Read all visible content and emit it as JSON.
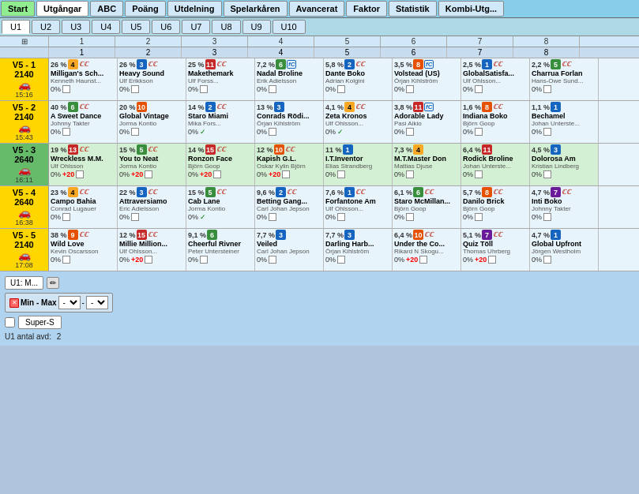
{
  "topNav": {
    "buttons": [
      {
        "label": "Start",
        "id": "start",
        "active": false
      },
      {
        "label": "Utgångar",
        "id": "utgangar",
        "active": true
      },
      {
        "label": "ABC",
        "id": "abc",
        "active": false
      },
      {
        "label": "Poäng",
        "id": "poang",
        "active": false
      },
      {
        "label": "Utdelning",
        "id": "utdelning",
        "active": false
      },
      {
        "label": "Spelarkåren",
        "id": "spelarkaren",
        "active": false
      },
      {
        "label": "Avancerat",
        "id": "avancerat",
        "active": false
      },
      {
        "label": "Faktor",
        "id": "faktor",
        "active": false
      },
      {
        "label": "Statistik",
        "id": "statistik",
        "active": false
      },
      {
        "label": "Kombi-Utg...",
        "id": "kombi",
        "active": false
      }
    ]
  },
  "tabs": [
    "U1",
    "U2",
    "U3",
    "U4",
    "U5",
    "U6",
    "U7",
    "U8",
    "U9",
    "U10"
  ],
  "activeTab": "U1",
  "colHeaders": [
    "",
    "1",
    "2",
    "3",
    "4",
    "5",
    "6",
    "7",
    "8"
  ],
  "races": [
    {
      "id": "v5-1",
      "label": "V5 - 1",
      "num": "2140",
      "time": "15:16",
      "horses": [
        {
          "pct": "26 %",
          "num": "4",
          "cc": true,
          "name": "Milligan's Sch...",
          "trainer": "Kenneth Haunst...",
          "pctBot": "0%",
          "plus": "",
          "checked": false,
          "badgeColor": "badge-yellow",
          "fcIcon": false
        },
        {
          "pct": "26 %",
          "num": "3",
          "cc": true,
          "name": "Heavy Sound",
          "trainer": "Ulf Erikkson",
          "pctBot": "0%",
          "plus": "",
          "checked": false,
          "badgeColor": "badge-blue",
          "fcIcon": false
        },
        {
          "pct": "25 %",
          "num": "11",
          "cc": true,
          "name": "Makethemark",
          "trainer": "Ulf Forss...",
          "pctBot": "0%",
          "plus": "",
          "checked": false,
          "badgeColor": "badge-red",
          "fcIcon": false
        },
        {
          "pct": "7,2 %",
          "num": "6",
          "cc": false,
          "name": "Nadal Broline",
          "trainer": "Erik Adielsson",
          "pctBot": "0%",
          "plus": "",
          "checked": false,
          "badgeColor": "badge-green",
          "fcIcon": true
        },
        {
          "pct": "5,8 %",
          "num": "2",
          "cc": true,
          "name": "Dante Boko",
          "trainer": "Adrian Kolgini",
          "pctBot": "0%",
          "plus": "",
          "checked": false,
          "badgeColor": "badge-blue",
          "fcIcon": false
        },
        {
          "pct": "3,5 %",
          "num": "8",
          "cc": false,
          "name": "Volstead (US)",
          "trainer": "Örjan Kihlström",
          "pctBot": "0%",
          "plus": "",
          "checked": false,
          "badgeColor": "badge-orange",
          "fcIcon": true
        },
        {
          "pct": "2,5 %",
          "num": "1",
          "cc": true,
          "name": "GlobalSatisfa...",
          "trainer": "Ulf Ohlsson...",
          "pctBot": "0%",
          "plus": "",
          "checked": false,
          "badgeColor": "badge-blue",
          "fcIcon": false
        },
        {
          "pct": "2,2 %",
          "num": "5",
          "cc": true,
          "name": "Charrua Forlan",
          "trainer": "Hans-Owe Sund...",
          "pctBot": "0%",
          "plus": "",
          "checked": false,
          "badgeColor": "badge-green",
          "fcIcon": false
        }
      ]
    },
    {
      "id": "v5-2",
      "label": "V5 - 2",
      "num": "2140",
      "time": "15:43",
      "horses": [
        {
          "pct": "40 %",
          "num": "6",
          "cc": true,
          "name": "A Sweet Dance",
          "trainer": "Johnny Takter",
          "pctBot": "0%",
          "plus": "",
          "checked": false,
          "badgeColor": "badge-green",
          "fcIcon": false
        },
        {
          "pct": "20 %",
          "num": "10",
          "cc": false,
          "name": "Global Vintage",
          "trainer": "Jorma Kontio",
          "pctBot": "0%",
          "plus": "",
          "checked": false,
          "badgeColor": "badge-orange",
          "fcIcon": false
        },
        {
          "pct": "14 %",
          "num": "2",
          "cc": true,
          "name": "Staro Miami",
          "trainer": "Mika Fors...",
          "pctBot": "0%",
          "plus": "",
          "checked": true,
          "badgeColor": "badge-blue",
          "fcIcon": false
        },
        {
          "pct": "13 %",
          "num": "3",
          "cc": false,
          "name": "Conrads Rödi...",
          "trainer": "Örjan Kihlström",
          "pctBot": "0%",
          "plus": "",
          "checked": false,
          "badgeColor": "badge-blue",
          "fcIcon": false
        },
        {
          "pct": "4,1 %",
          "num": "4",
          "cc": true,
          "name": "Zeta Kronos",
          "trainer": "Ulf Ohlsson...",
          "pctBot": "0%",
          "plus": "",
          "checked": true,
          "badgeColor": "badge-yellow",
          "fcIcon": false
        },
        {
          "pct": "3,8 %",
          "num": "11",
          "cc": false,
          "name": "Adorable Lady",
          "trainer": "Pasi Aikio",
          "pctBot": "0%",
          "plus": "",
          "checked": false,
          "badgeColor": "badge-red",
          "fcIcon": true
        },
        {
          "pct": "1,6 %",
          "num": "8",
          "cc": true,
          "name": "Indiana Boko",
          "trainer": "Björn Goop",
          "pctBot": "0%",
          "plus": "",
          "checked": false,
          "badgeColor": "badge-orange",
          "fcIcon": false
        },
        {
          "pct": "1,1 %",
          "num": "1",
          "cc": false,
          "name": "Bechamel",
          "trainer": "Johan Unterste...",
          "pctBot": "0%",
          "plus": "",
          "checked": false,
          "badgeColor": "badge-blue",
          "fcIcon": false
        }
      ]
    },
    {
      "id": "v5-3",
      "label": "V5 - 3",
      "num": "2640",
      "time": "16:11",
      "highlight": true,
      "horses": [
        {
          "pct": "19 %",
          "num": "13",
          "cc": true,
          "name": "Wreckless M.M.",
          "trainer": "Ulf Ohlsson",
          "pctBot": "0%",
          "plus": "+20",
          "checked": false,
          "badgeColor": "badge-red",
          "fcIcon": false
        },
        {
          "pct": "15 %",
          "num": "5",
          "cc": true,
          "name": "You to Neat",
          "trainer": "Jorma Kontio",
          "pctBot": "0%",
          "plus": "+20",
          "checked": false,
          "badgeColor": "badge-green",
          "fcIcon": false
        },
        {
          "pct": "14 %",
          "num": "15",
          "cc": true,
          "name": "Ronzon Face",
          "trainer": "Björn Goop",
          "pctBot": "0%",
          "plus": "+20",
          "checked": false,
          "badgeColor": "badge-red",
          "fcIcon": false
        },
        {
          "pct": "12 %",
          "num": "10",
          "cc": true,
          "name": "Kapish G.L.",
          "trainer": "Oskar Kylin Björn",
          "pctBot": "0%",
          "plus": "+20",
          "checked": false,
          "badgeColor": "badge-orange",
          "fcIcon": false
        },
        {
          "pct": "11 %",
          "num": "1",
          "cc": false,
          "name": "I.T.Inventor",
          "trainer": "Elias Strandberg",
          "pctBot": "0%",
          "plus": "",
          "checked": false,
          "badgeColor": "badge-blue",
          "fcIcon": false
        },
        {
          "pct": "7,3 %",
          "num": "4",
          "cc": false,
          "name": "M.T.Master Don",
          "trainer": "Mattias Djuse",
          "pctBot": "0%",
          "plus": "",
          "checked": false,
          "badgeColor": "badge-yellow",
          "fcIcon": false
        },
        {
          "pct": "6,4 %",
          "num": "11",
          "cc": false,
          "name": "Rodick Broline",
          "trainer": "Johan Unterste...",
          "pctBot": "0%",
          "plus": "",
          "checked": false,
          "badgeColor": "badge-red",
          "fcIcon": false
        },
        {
          "pct": "4,5 %",
          "num": "3",
          "cc": false,
          "name": "Dolorosa Am",
          "trainer": "Kristian Lindberg",
          "pctBot": "0%",
          "plus": "",
          "checked": false,
          "badgeColor": "badge-blue",
          "fcIcon": false
        }
      ]
    },
    {
      "id": "v5-4",
      "label": "V5 - 4",
      "num": "2640",
      "time": "16:38",
      "horses": [
        {
          "pct": "23 %",
          "num": "4",
          "cc": true,
          "name": "Campo Bahia",
          "trainer": "Conrad Lugauer",
          "pctBot": "0%",
          "plus": "",
          "checked": false,
          "badgeColor": "badge-yellow",
          "fcIcon": false
        },
        {
          "pct": "22 %",
          "num": "3",
          "cc": true,
          "name": "Attraversiamo",
          "trainer": "Eric Adielsson",
          "pctBot": "0%",
          "plus": "",
          "checked": false,
          "badgeColor": "badge-blue",
          "fcIcon": false
        },
        {
          "pct": "15 %",
          "num": "5",
          "cc": true,
          "name": "Cab Lane",
          "trainer": "Jorma Kontio",
          "pctBot": "0%",
          "plus": "",
          "checked": true,
          "badgeColor": "badge-green",
          "fcIcon": false
        },
        {
          "pct": "9,6 %",
          "num": "2",
          "cc": true,
          "name": "Betting Gang...",
          "trainer": "Carl Johan Jepson",
          "pctBot": "0%",
          "plus": "",
          "checked": false,
          "badgeColor": "badge-blue",
          "fcIcon": false
        },
        {
          "pct": "7,6 %",
          "num": "1",
          "cc": true,
          "name": "Forfantone Am",
          "trainer": "Ulf Ohlsson...",
          "pctBot": "0%",
          "plus": "",
          "checked": false,
          "badgeColor": "badge-blue",
          "fcIcon": false
        },
        {
          "pct": "6,1 %",
          "num": "6",
          "cc": true,
          "name": "Staro McMillan...",
          "trainer": "Björn Goop",
          "pctBot": "0%",
          "plus": "",
          "checked": false,
          "badgeColor": "badge-green",
          "fcIcon": false
        },
        {
          "pct": "5,7 %",
          "num": "8",
          "cc": true,
          "name": "Danilo Brick",
          "trainer": "Björn Goop",
          "pctBot": "0%",
          "plus": "",
          "checked": false,
          "badgeColor": "badge-orange",
          "fcIcon": false
        },
        {
          "pct": "4,7 %",
          "num": "7",
          "cc": true,
          "name": "Inti Boko",
          "trainer": "Johnny Takter",
          "pctBot": "0%",
          "plus": "",
          "checked": false,
          "badgeColor": "badge-purple",
          "fcIcon": false
        }
      ]
    },
    {
      "id": "v5-5",
      "label": "V5 - 5",
      "num": "2140",
      "time": "17:08",
      "horses": [
        {
          "pct": "38 %",
          "num": "9",
          "cc": true,
          "name": "Wild Love",
          "trainer": "Kevin Oscarsson",
          "pctBot": "0%",
          "plus": "",
          "checked": false,
          "badgeColor": "badge-orange",
          "fcIcon": false
        },
        {
          "pct": "12 %",
          "num": "15",
          "cc": true,
          "name": "Millie Million...",
          "trainer": "Ulf Ohlsson...",
          "pctBot": "0%",
          "plus": "+20",
          "checked": false,
          "badgeColor": "badge-red",
          "fcIcon": false
        },
        {
          "pct": "9,1 %",
          "num": "6",
          "cc": false,
          "name": "Cheerful Rivner",
          "trainer": "Peter Untersteiner",
          "pctBot": "0%",
          "plus": "",
          "checked": false,
          "badgeColor": "badge-green",
          "fcIcon": false
        },
        {
          "pct": "7,7 %",
          "num": "3",
          "cc": false,
          "name": "Veiled",
          "trainer": "Carl Johan Jepson",
          "pctBot": "0%",
          "plus": "",
          "checked": false,
          "badgeColor": "badge-blue",
          "fcIcon": false
        },
        {
          "pct": "7,7 %",
          "num": "3",
          "cc": false,
          "name": "Darling Harb...",
          "trainer": "Örjan Kihlström",
          "pctBot": "0%",
          "plus": "",
          "checked": false,
          "badgeColor": "badge-blue",
          "fcIcon": false
        },
        {
          "pct": "6,4 %",
          "num": "10",
          "cc": true,
          "name": "Under the Co...",
          "trainer": "Rikard N Skogu...",
          "pctBot": "0%",
          "plus": "+20",
          "checked": false,
          "badgeColor": "badge-orange",
          "fcIcon": false
        },
        {
          "pct": "5,1 %",
          "num": "7",
          "cc": true,
          "name": "Quiz Töll",
          "trainer": "Thomas Uhrberg",
          "pctBot": "0%",
          "plus": "+20",
          "checked": false,
          "badgeColor": "badge-purple",
          "fcIcon": false
        },
        {
          "pct": "4,7 %",
          "num": "1",
          "cc": false,
          "name": "Global Upfront",
          "trainer": "Jörgen Westholm",
          "pctBot": "0%",
          "plus": "",
          "checked": false,
          "badgeColor": "badge-blue",
          "fcIcon": false
        }
      ]
    }
  ],
  "bottom": {
    "u1Label": "U1: M...",
    "minMaxLabel": "Min - Max",
    "superSLabel": "Super-S",
    "antalLabel": "U1 antal avd:",
    "antalValue": "2"
  }
}
